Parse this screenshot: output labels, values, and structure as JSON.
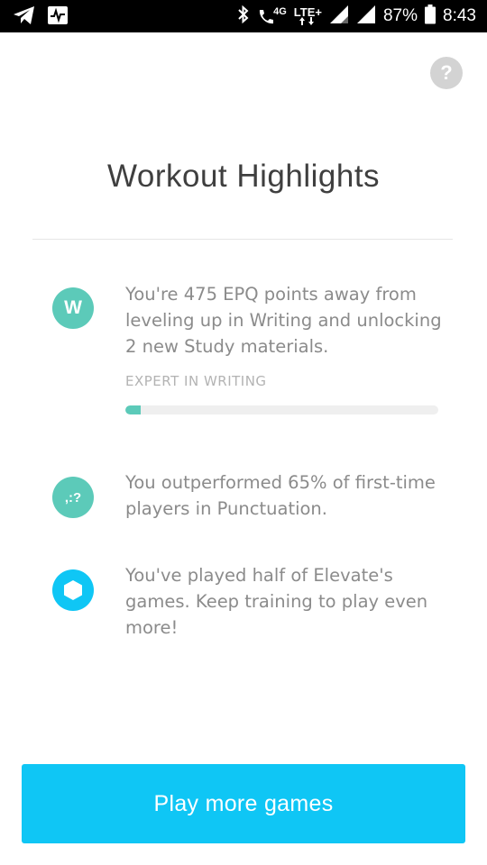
{
  "status_bar": {
    "network_4g": "4G",
    "network_lte": "LTE+",
    "battery_percent": "87%",
    "time": "8:43"
  },
  "help": {
    "label": "?"
  },
  "page": {
    "title": "Workout Highlights"
  },
  "highlights": [
    {
      "icon_letter": "W",
      "icon_color": "#5ccab9",
      "text": "You're 475 EPQ points away from leveling up in Writing and unlocking 2 new Study materials.",
      "label": "EXPERT IN WRITING",
      "progress": 0.05
    },
    {
      "icon_glyph": ",:?",
      "icon_color": "#5ccab9",
      "text": "You outperformed 65% of first-time players in Punctuation."
    },
    {
      "icon_color": "#0fc6f5",
      "text": "You've played half of Elevate's games. Keep training to play even more!"
    }
  ],
  "cta": {
    "label": "Play more games"
  }
}
